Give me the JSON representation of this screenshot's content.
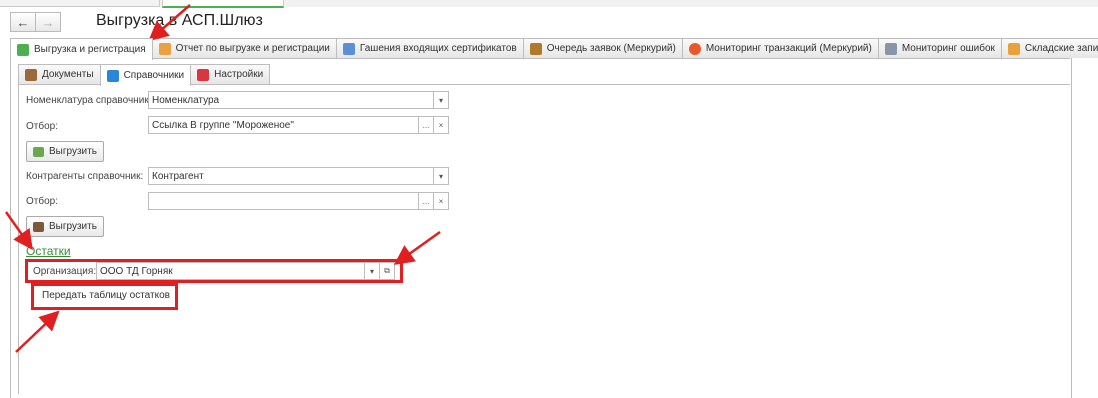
{
  "window": {
    "title": "Выгрузка в АСП.Шлюз"
  },
  "nav": {
    "back": "←",
    "forward": "→"
  },
  "main_tabs": [
    {
      "label": "Выгрузка и регистрация",
      "color": "#4caf50",
      "icon": "upload-icon"
    },
    {
      "label": "Отчет по выгрузке и регистрации",
      "color": "#e8a040",
      "icon": "report-icon"
    },
    {
      "label": "Гашения входящих сертификатов",
      "color": "#5b8fd6",
      "icon": "certificate-icon"
    },
    {
      "label": "Очередь заявок (Меркурий)",
      "color": "#b07a2a",
      "icon": "queue-icon"
    },
    {
      "label": "Мониторинг транзакций (Меркурий)",
      "color": "#e9572a",
      "icon": "chart-icon"
    },
    {
      "label": "Мониторинг ошибок",
      "color": "#8b95a8",
      "icon": "monitor-icon"
    },
    {
      "label": "Складские записи",
      "color": "#e9a23b",
      "icon": "warehouse-icon"
    }
  ],
  "sub_tabs": [
    {
      "label": "Документы",
      "color": "#9a6a3a",
      "icon": "briefcase-icon"
    },
    {
      "label": "Справочники",
      "color": "#2c86d8",
      "icon": "directory-icon"
    },
    {
      "label": "Настройки",
      "color": "#d9363e",
      "icon": "settings-icon"
    }
  ],
  "nomenclature": {
    "label": "Номенклатура справочник:",
    "value": "Номенклатура",
    "filter_label": "Отбор:",
    "filter_value": "Ссылка В группе \"Мороженое\"",
    "export_button": "Выгрузить"
  },
  "contractors": {
    "label": "Контрагенты справочник:",
    "value": "Контрагент",
    "filter_label": "Отбор:",
    "filter_value": "",
    "export_button": "Выгрузить"
  },
  "balances": {
    "link": "Остатки",
    "org_label": "Организация:",
    "org_value": "ООО ТД Горняк",
    "send_button": "Передать таблицу остатков"
  },
  "icons": {
    "dropdown": "▾",
    "ellipsis": "...",
    "clear": "×",
    "open": "⧉"
  },
  "colors": {
    "annotation_red": "#e02020",
    "link_green": "#3a8a3a"
  }
}
